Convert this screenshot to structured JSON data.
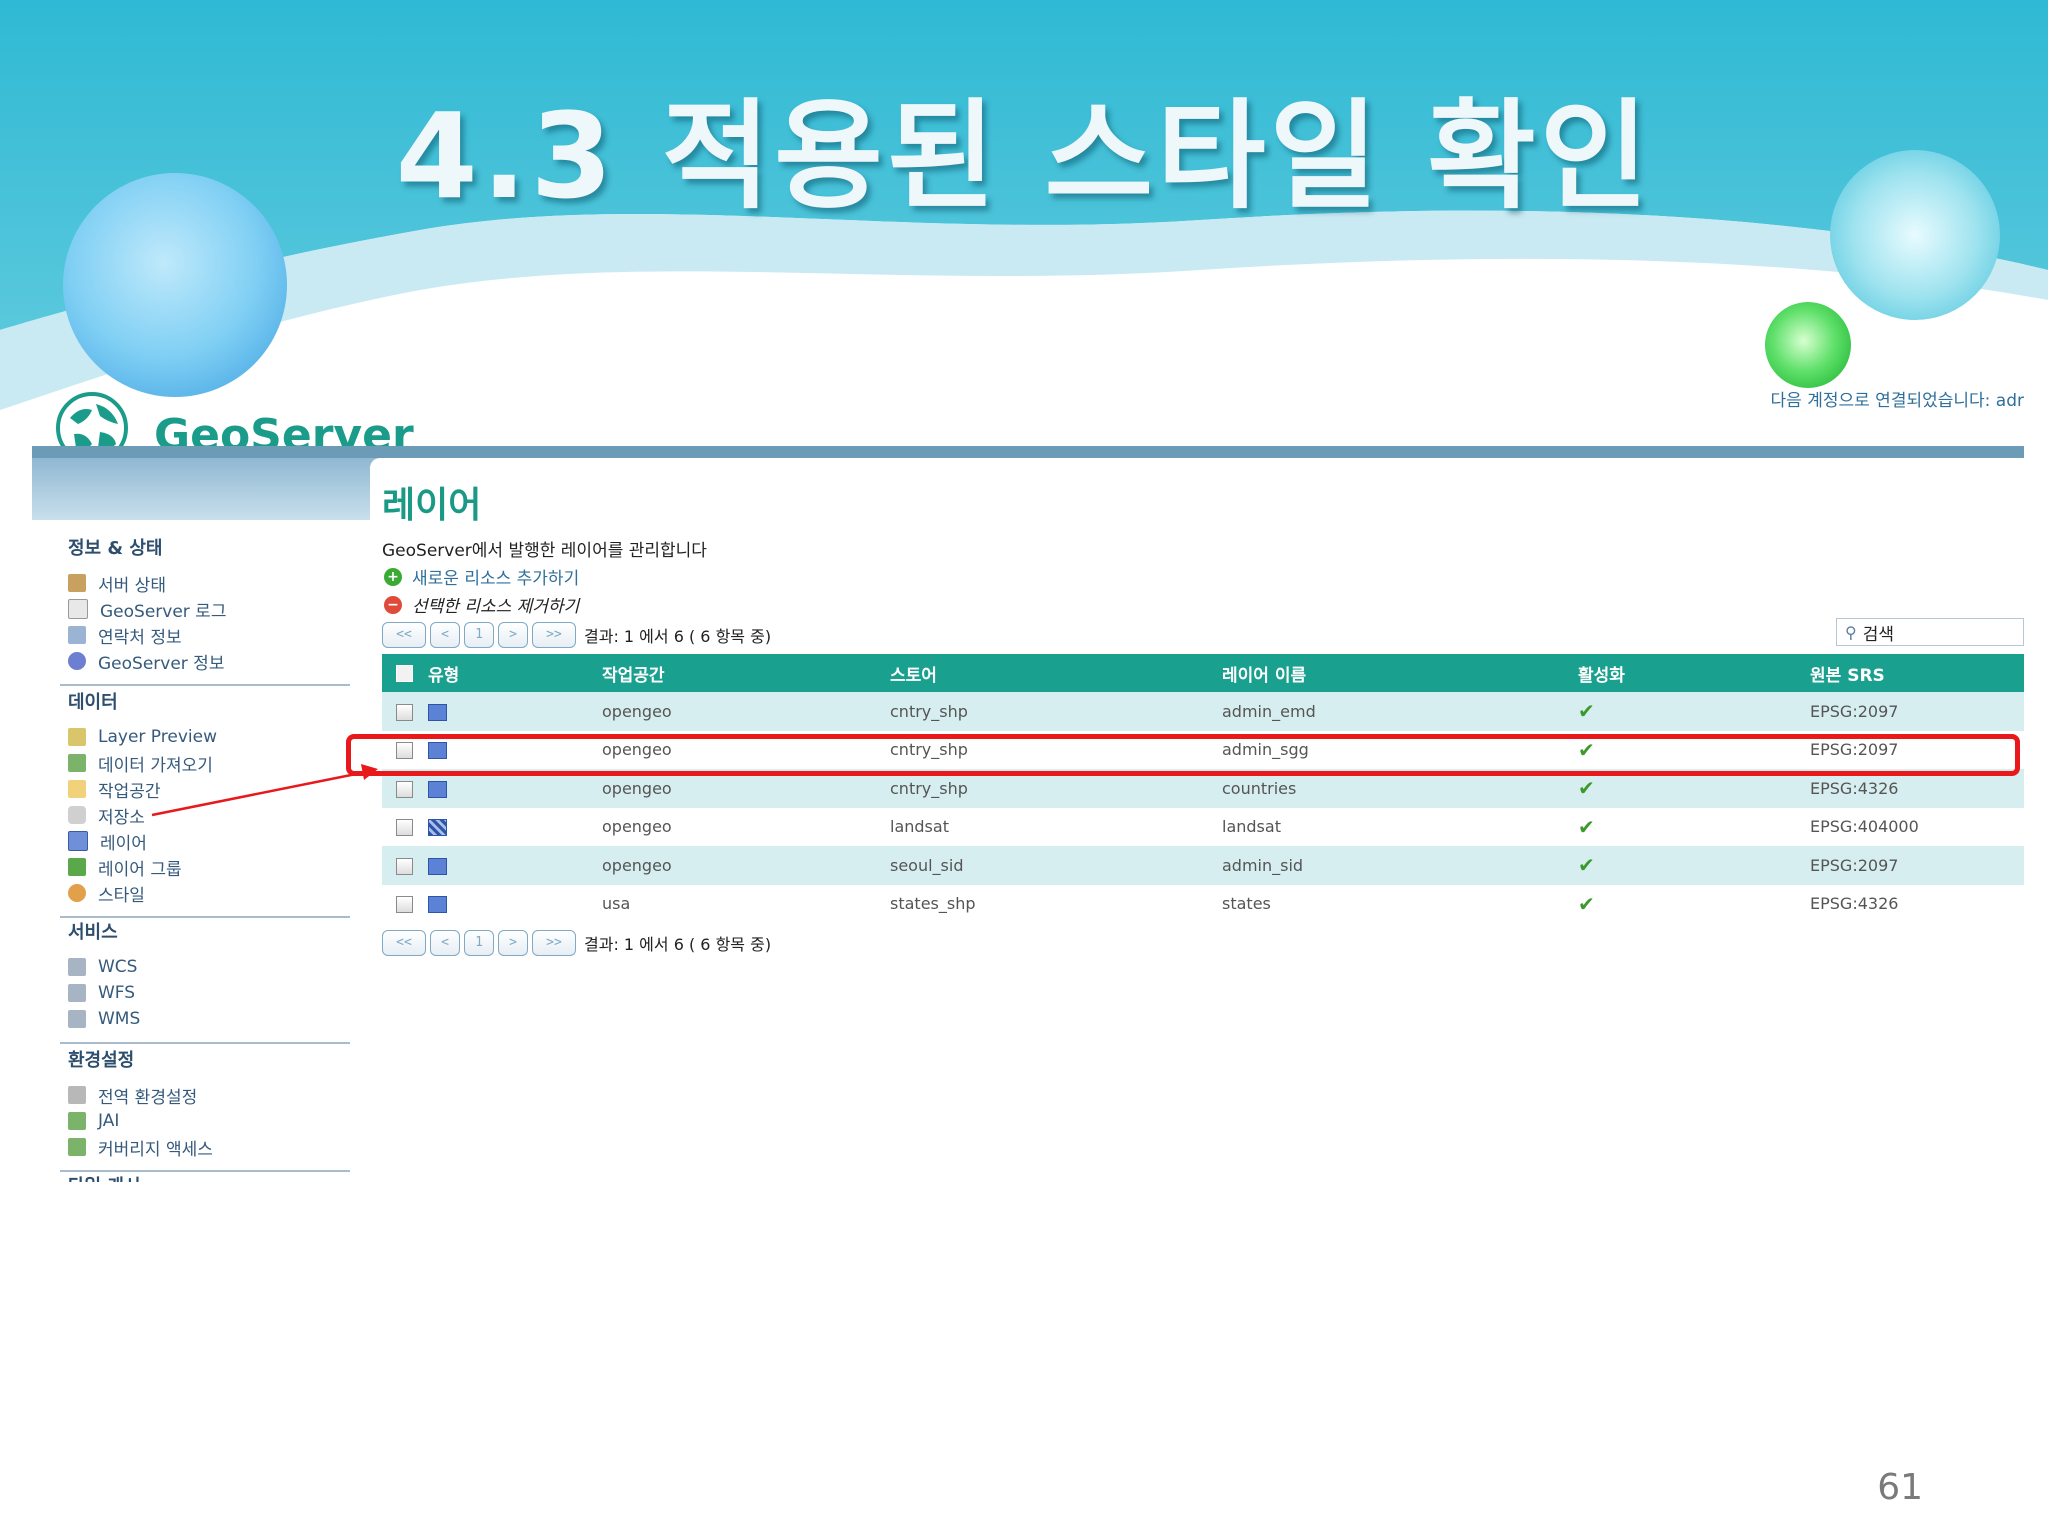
{
  "slide": {
    "title": "4.3 적용된 스타일 확인",
    "page_number": "61"
  },
  "geoserver": {
    "logo_text": "GeoServer",
    "login_status": "다음 계정으로 연결되었습니다: adr",
    "sidebar": {
      "sections": [
        {
          "heading": "정보 & 상태",
          "items": [
            "서버 상태",
            "GeoServer 로그",
            "연락처 정보",
            "GeoServer 정보"
          ]
        },
        {
          "heading": "데이터",
          "items": [
            "Layer Preview",
            "데이터 가져오기",
            "작업공간",
            "저장소",
            "레이어",
            "레이어 그룹",
            "스타일"
          ]
        },
        {
          "heading": "서비스",
          "items": [
            "WCS",
            "WFS",
            "WMS"
          ]
        },
        {
          "heading": "환경설정",
          "items": [
            "전역 환경설정",
            "JAI",
            "커버리지 액세스"
          ]
        },
        {
          "heading": "타일 캐시",
          "items": []
        }
      ]
    },
    "main": {
      "title": "레이어",
      "description": "GeoServer에서 발행한 레이어를 관리합니다",
      "add_action": "새로운 리소스 추가하기",
      "remove_action": "선택한 리소스 제거하기",
      "pager": {
        "first": "<<",
        "prev": "<",
        "page": "1",
        "next": ">",
        "last": ">>",
        "result_text": "결과: 1 에서 6 ( 6 항목 중)"
      },
      "search_placeholder": "검색",
      "columns": [
        "유형",
        "작업공간",
        "스토어",
        "레이어 이름",
        "활성화",
        "원본 SRS"
      ],
      "rows": [
        {
          "type": "vector",
          "workspace": "opengeo",
          "store": "cntry_shp",
          "layer": "admin_emd",
          "enabled": "✔",
          "srs": "EPSG:2097"
        },
        {
          "type": "vector",
          "workspace": "opengeo",
          "store": "cntry_shp",
          "layer": "admin_sgg",
          "enabled": "✔",
          "srs": "EPSG:2097"
        },
        {
          "type": "vector",
          "workspace": "opengeo",
          "store": "cntry_shp",
          "layer": "countries",
          "enabled": "✔",
          "srs": "EPSG:4326"
        },
        {
          "type": "raster",
          "workspace": "opengeo",
          "store": "landsat",
          "layer": "landsat",
          "enabled": "✔",
          "srs": "EPSG:404000"
        },
        {
          "type": "vector",
          "workspace": "opengeo",
          "store": "seoul_sid",
          "layer": "admin_sid",
          "enabled": "✔",
          "srs": "EPSG:2097"
        },
        {
          "type": "vector",
          "workspace": "usa",
          "store": "states_shp",
          "layer": "states",
          "enabled": "✔",
          "srs": "EPSG:4326"
        }
      ]
    }
  },
  "colors": {
    "accent": "#1aa08f",
    "highlight": "#e8181b",
    "link": "#2f6f9a"
  }
}
